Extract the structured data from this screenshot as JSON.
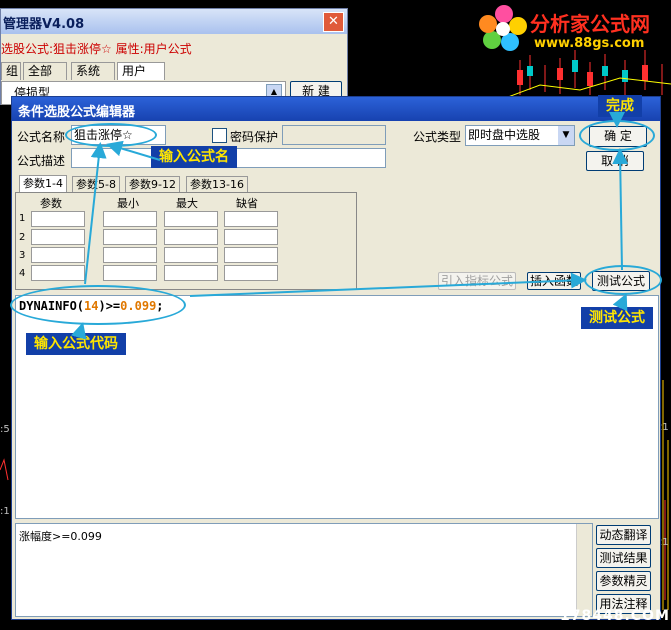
{
  "logo": {
    "brand": "分析家公式网",
    "url": "www.88gs.com"
  },
  "back_window": {
    "title": "管理器V4.08",
    "close_glyph": "✕",
    "formula_line": "选股公式:狙击涨停☆ 属性:用户公式",
    "tabs": [
      "组",
      "全部",
      "系统",
      "用户"
    ],
    "tree_item": "停损型",
    "new_button": "新 建"
  },
  "dialog": {
    "title": "条件选股公式编辑器",
    "name_label": "公式名称",
    "name_value": "狙击涨停☆",
    "password_label": "密码保护",
    "type_label": "公式类型",
    "type_value": "即时盘中选股",
    "desc_label": "公式描述",
    "ok_button": "确 定",
    "cancel_button": "取 消",
    "param_tabs": [
      "参数1-4",
      "参数5-8",
      "参数9-12",
      "参数13-16"
    ],
    "param_headers": [
      "参数",
      "最小",
      "最大",
      "缺省"
    ],
    "param_rows": [
      "1",
      "2",
      "3",
      "4"
    ],
    "import_button": "引入指标公式",
    "insert_func_button": "插入函数",
    "test_button": "测试公式",
    "code": {
      "prefix": "DYNAINFO(",
      "arg": "14",
      "mid": ")>=",
      "value": "0.099",
      "suffix": ";"
    },
    "output_text": "涨幅度>=0.099",
    "side_buttons": [
      "动态翻译",
      "测试结果",
      "参数精灵",
      "用法注释"
    ]
  },
  "annotations": {
    "done": "完成",
    "enter_name": "输入公式名",
    "enter_code": "输入公式代码",
    "test": "测试公式"
  },
  "watermark": "178448.COM"
}
